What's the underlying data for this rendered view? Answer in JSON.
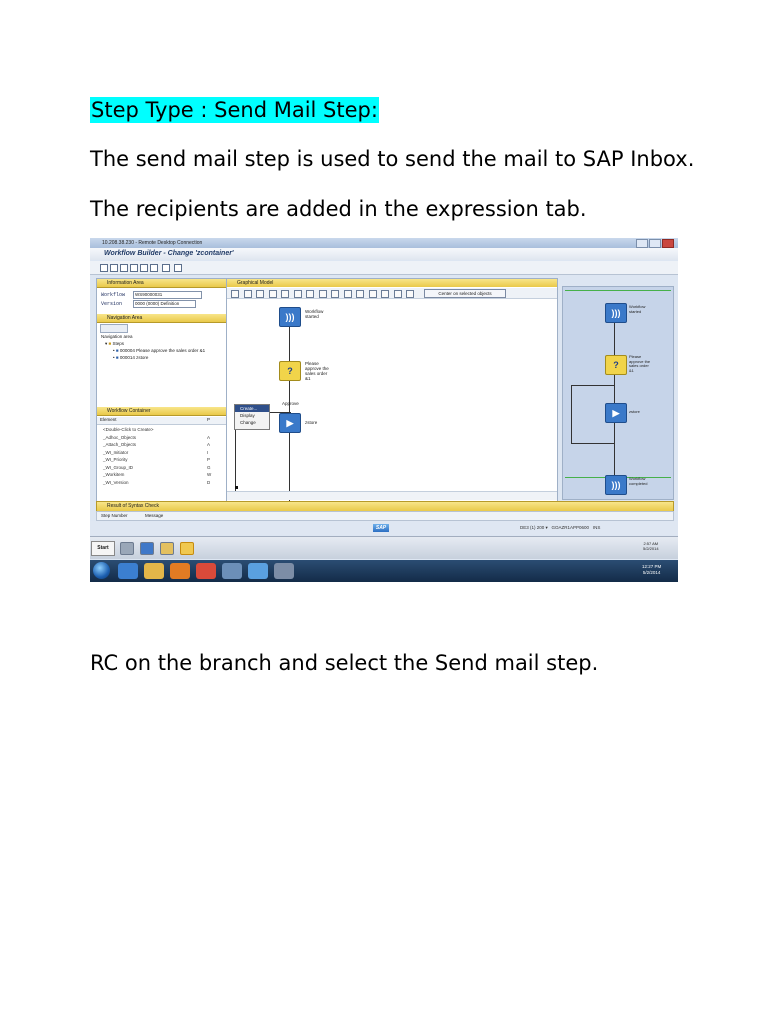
{
  "document": {
    "heading": "Step Type : Send Mail Step:",
    "para1": "The send mail step is used to send the mail to SAP Inbox.",
    "para2": "The recipients are added in the expression tab.",
    "para3": "RC on the branch and select the Send mail step."
  },
  "screenshot": {
    "rdp_title": "10.208.38.230 - Remote Desktop Connection",
    "window_title": "Workflow Builder - Change 'zcontainer'",
    "info_area": {
      "header": "Information Area",
      "workflow_label": "Workflow",
      "workflow_value": "WS90000031",
      "version_label": "Version",
      "version_value": "0000 (0000) Definition"
    },
    "navigation": {
      "header": "Navigation Area",
      "title": "Navigation area",
      "steps_label": "Steps",
      "step1": "000004 Please approve the sales order &1",
      "step2": "000014 zstore"
    },
    "container": {
      "header": "Workflow Container",
      "col_element": "Element",
      "col_p": "P",
      "rows": [
        {
          "text": "<Double-Click to Create>",
          "p": ""
        },
        {
          "text": "_Adhoc_Objects",
          "p": "A"
        },
        {
          "text": "_Attach_Objects",
          "p": "A"
        },
        {
          "text": "_WI_Initiator",
          "p": "I"
        },
        {
          "text": "_WI_Priority",
          "p": "P"
        },
        {
          "text": "_WI_Group_ID",
          "p": "G"
        },
        {
          "text": "_Workitem",
          "p": "W"
        },
        {
          "text": "_WI_Version",
          "p": "D"
        }
      ]
    },
    "graph": {
      "header": "Graphical Model",
      "center_button": "Center on selected objects",
      "node_started": "Workflow\nstarted",
      "node_approve": "Please\napprove the\nsales order\n&1",
      "branch_label": "Approve",
      "node_store": "zstore",
      "context_menu": [
        "Create...",
        "Display",
        "Change"
      ]
    },
    "overview": {
      "node_started": "Workflow\nstarted",
      "node_approve": "Please\napprove the\nsales order\n&1",
      "node_store": "zstore",
      "node_completed": "Workflow\ncompleted"
    },
    "syntax": {
      "header": "Result of Syntax Check",
      "col_step": "Step Number",
      "col_message": "Message"
    },
    "status_bar": {
      "logo": "SAP",
      "system": "DE3 (1) 200",
      "server": "GOAZR1APP0600",
      "mode": "INS"
    },
    "citrix": {
      "start": "Start",
      "time": "2:57 AM",
      "date": "5/2/2014"
    },
    "taskbar": {
      "time": "12:27 PM",
      "date": "5/2/2014"
    },
    "colors": {
      "heading_highlight": "#00ffff",
      "node_blue": "#3a79c9",
      "node_yellow": "#f1d44a",
      "section_header": "#f0d567"
    }
  }
}
